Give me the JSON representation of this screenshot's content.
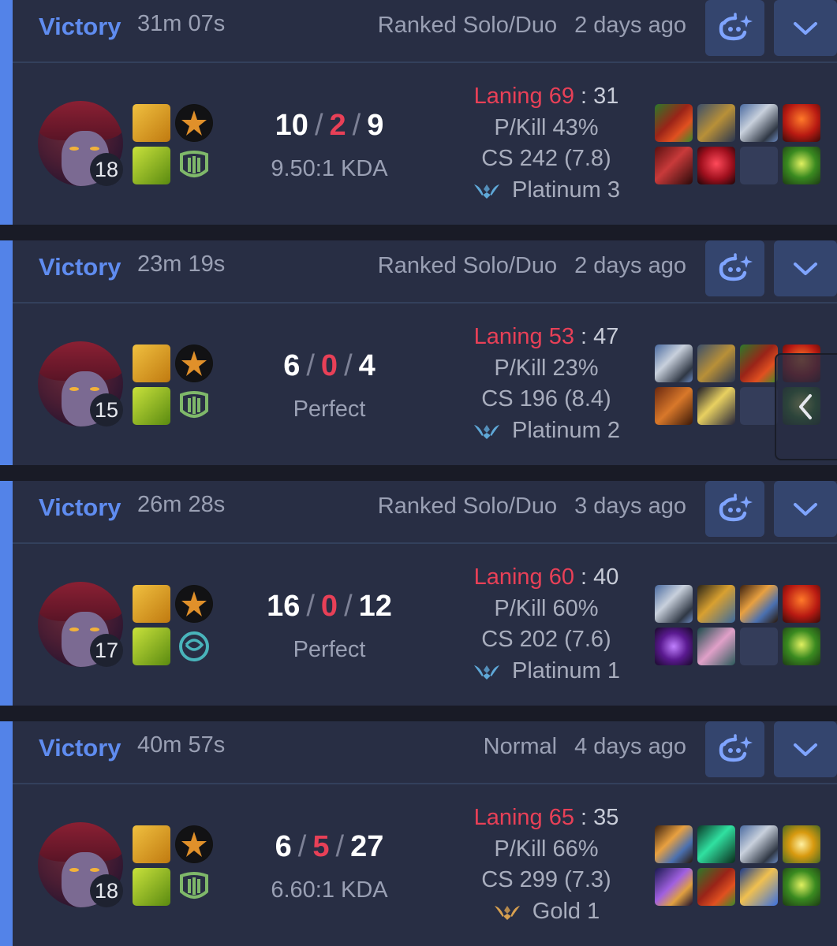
{
  "matches": [
    {
      "result": "Victory",
      "duration": "31m 07s",
      "queue": "Ranked Solo/Duo",
      "time_ago": "2 days ago",
      "level": "18",
      "kills": "10",
      "deaths": "2",
      "assists": "9",
      "kda_ratio": "9.50:1 KDA",
      "laning_label": "Laning 69",
      "laning_opp": "31",
      "pkill": "P/Kill 43%",
      "cs": "CS 242 (7.8)",
      "rank": "Platinum 3",
      "rank_tier": "platinum",
      "rune2": "resolve-rune-icon",
      "items": [
        "red-sword-item",
        "knight-helm-item",
        "silver-bracer-item",
        "lava-item",
        "crimson-blade-item",
        "ruby-crystal-item",
        "empty",
        "green-ward-item"
      ]
    },
    {
      "result": "Victory",
      "duration": "23m 19s",
      "queue": "Ranked Solo/Duo",
      "time_ago": "2 days ago",
      "level": "15",
      "kills": "6",
      "deaths": "0",
      "assists": "4",
      "kda_ratio": "Perfect",
      "laning_label": "Laning 53",
      "laning_opp": "47",
      "pkill": "P/Kill 23%",
      "cs": "CS 196 (8.4)",
      "rank": "Platinum 2",
      "rank_tier": "platinum",
      "rune2": "resolve-rune-icon",
      "items": [
        "silver-bracer-item",
        "knight-helm-item",
        "red-sword-item",
        "lava-item",
        "bronze-boots-item",
        "star-mace-item",
        "empty",
        "green-ward-item"
      ]
    },
    {
      "result": "Victory",
      "duration": "26m 28s",
      "queue": "Ranked Solo/Duo",
      "time_ago": "3 days ago",
      "level": "17",
      "kills": "16",
      "deaths": "0",
      "assists": "12",
      "kda_ratio": "Perfect",
      "laning_label": "Laning 60",
      "laning_opp": "40",
      "pkill": "P/Kill 60%",
      "cs": "CS 202 (7.6)",
      "rank": "Platinum 1",
      "rank_tier": "platinum",
      "rune2": "inspiration-rune-icon",
      "items": [
        "silver-bracer-item",
        "golden-cannon-item",
        "triple-blade-item",
        "lava-item",
        "purple-orb-item",
        "pink-cat-item",
        "empty",
        "green-ward-item"
      ]
    },
    {
      "result": "Victory",
      "duration": "40m 57s",
      "queue": "Normal",
      "time_ago": "4 days ago",
      "level": "18",
      "kills": "6",
      "deaths": "5",
      "assists": "27",
      "kda_ratio": "6.60:1 KDA",
      "laning_label": "Laning 65",
      "laning_opp": "35",
      "pkill": "P/Kill 66%",
      "cs": "CS 299 (7.3)",
      "rank": "Gold 1",
      "rank_tier": "gold",
      "rune2": "resolve-rune-icon",
      "items": [
        "triple-blade-item",
        "green-slash-item",
        "silver-bracer-item",
        "golden-sun-item",
        "violet-staff-item",
        "red-sword-item",
        "blue-crescent-item",
        "green-ward-item"
      ]
    }
  ],
  "colors": {
    "victory": "#5f8cf0",
    "stripe": "#5383e8",
    "card": "#282e44",
    "deaths": "#e84057",
    "button": "#34456e"
  },
  "icons": {
    "ai": "robot-sparkle-icon",
    "expand": "chevron-down-icon",
    "side": "chevron-left-icon"
  }
}
